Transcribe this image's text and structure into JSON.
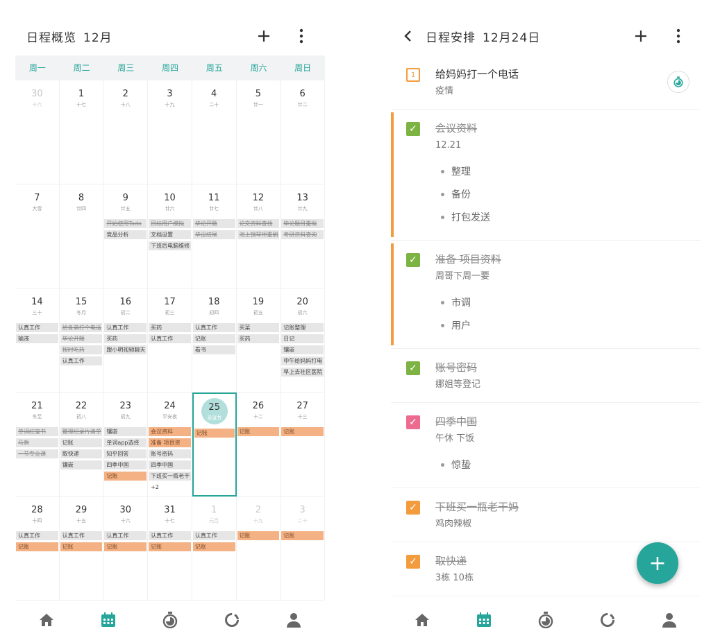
{
  "left": {
    "title": "日程概览",
    "month": "12月",
    "weekdays": [
      "周一",
      "周二",
      "周三",
      "周四",
      "周五",
      "周六",
      "周日"
    ],
    "weeks": [
      [
        {
          "d": "30",
          "l": "十六",
          "dim": true,
          "ev": []
        },
        {
          "d": "1",
          "l": "十七",
          "ev": []
        },
        {
          "d": "2",
          "l": "十八",
          "ev": []
        },
        {
          "d": "3",
          "l": "十九",
          "ev": []
        },
        {
          "d": "4",
          "l": "二十",
          "ev": []
        },
        {
          "d": "5",
          "l": "廿一",
          "ev": []
        },
        {
          "d": "6",
          "l": "廿二",
          "ev": []
        }
      ],
      [
        {
          "d": "7",
          "l": "大雪",
          "ev": []
        },
        {
          "d": "8",
          "l": "廿四",
          "ev": []
        },
        {
          "d": "9",
          "l": "廿五",
          "ev": [
            {
              "t": "开始使用Todo",
              "s": "done"
            },
            {
              "t": "竞品分析",
              "s": ""
            }
          ]
        },
        {
          "d": "10",
          "l": "廿六",
          "ev": [
            {
              "t": "目标用户模拟",
              "s": "done"
            },
            {
              "t": "文档设置",
              "s": ""
            },
            {
              "t": "下班后电脑维修",
              "s": ""
            }
          ]
        },
        {
          "d": "11",
          "l": "廿七",
          "ev": [
            {
              "t": "毕论开题",
              "s": "done"
            },
            {
              "t": "毕设结尾",
              "s": "done"
            }
          ]
        },
        {
          "d": "12",
          "l": "廿八",
          "ev": [
            {
              "t": "论文资料查找",
              "s": "done"
            },
            {
              "t": "海上钢琴师重刷",
              "s": "done"
            }
          ]
        },
        {
          "d": "13",
          "l": "廿九",
          "ev": [
            {
              "t": "毕论题目重拟",
              "s": "done"
            },
            {
              "t": "考研资料查询",
              "s": "done"
            }
          ]
        }
      ],
      [
        {
          "d": "14",
          "l": "三十",
          "ev": [
            {
              "t": "认真工作",
              "s": ""
            },
            {
              "t": "输液",
              "s": ""
            }
          ]
        },
        {
          "d": "15",
          "l": "冬月",
          "ev": [
            {
              "t": "给各弟打个电话",
              "s": "done"
            },
            {
              "t": "毕论开题",
              "s": "done"
            },
            {
              "t": "按时吃药",
              "s": "done"
            },
            {
              "t": "认真工作",
              "s": ""
            }
          ]
        },
        {
          "d": "16",
          "l": "初二",
          "ev": [
            {
              "t": "认真工作",
              "s": ""
            },
            {
              "t": "买药",
              "s": ""
            },
            {
              "t": "跟小明视频聊天",
              "s": ""
            }
          ]
        },
        {
          "d": "17",
          "l": "初三",
          "ev": [
            {
              "t": "买药",
              "s": ""
            },
            {
              "t": "认真工作",
              "s": ""
            }
          ]
        },
        {
          "d": "18",
          "l": "初四",
          "ev": [
            {
              "t": "认真工作",
              "s": ""
            },
            {
              "t": "记账",
              "s": ""
            },
            {
              "t": "看书",
              "s": ""
            }
          ]
        },
        {
          "d": "19",
          "l": "初五",
          "ev": [
            {
              "t": "买菜",
              "s": ""
            },
            {
              "t": "买药",
              "s": ""
            }
          ]
        },
        {
          "d": "20",
          "l": "初六",
          "ev": [
            {
              "t": "记账整理",
              "s": ""
            },
            {
              "t": "日记",
              "s": ""
            },
            {
              "t": "镶嵌",
              "s": ""
            },
            {
              "t": "中午给妈妈打电",
              "s": ""
            },
            {
              "t": "早上去社区医院",
              "s": ""
            }
          ]
        }
      ],
      [
        {
          "d": "21",
          "l": "冬至",
          "ev": [
            {
              "t": "单词红宝书",
              "s": "done"
            },
            {
              "t": "马哲",
              "s": "done"
            },
            {
              "t": "一节专业课",
              "s": "done"
            }
          ]
        },
        {
          "d": "22",
          "l": "初八",
          "ev": [
            {
              "t": "整理纪录片清单",
              "s": "done"
            },
            {
              "t": "记账",
              "s": ""
            },
            {
              "t": "取快递",
              "s": ""
            },
            {
              "t": "镶嵌",
              "s": ""
            }
          ]
        },
        {
          "d": "23",
          "l": "初九",
          "ev": [
            {
              "t": "镶嵌",
              "s": ""
            },
            {
              "t": "单词app选择",
              "s": ""
            },
            {
              "t": "知乎回答",
              "s": ""
            },
            {
              "t": "四季中国",
              "s": ""
            },
            {
              "t": "记账",
              "s": "or"
            }
          ]
        },
        {
          "d": "24",
          "l": "平安夜",
          "ev": [
            {
              "t": "会议资料",
              "s": "or"
            },
            {
              "t": "准备  项目资",
              "s": "or"
            },
            {
              "t": "账号密码",
              "s": ""
            },
            {
              "t": "四季中国",
              "s": ""
            },
            {
              "t": "下班买一瓶老干",
              "s": ""
            },
            {
              "t": "+2",
              "s": "more"
            }
          ]
        },
        {
          "d": "25",
          "l": "圣诞节",
          "today": true,
          "ev": [
            {
              "t": "记账",
              "s": "or"
            }
          ]
        },
        {
          "d": "26",
          "l": "十二",
          "ev": [
            {
              "t": "记账",
              "s": "or"
            }
          ]
        },
        {
          "d": "27",
          "l": "十三",
          "ev": [
            {
              "t": "记账",
              "s": "or"
            }
          ]
        }
      ],
      [
        {
          "d": "28",
          "l": "十四",
          "ev": [
            {
              "t": "认真工作",
              "s": ""
            },
            {
              "t": "记账",
              "s": "or"
            }
          ]
        },
        {
          "d": "29",
          "l": "十五",
          "ev": [
            {
              "t": "认真工作",
              "s": ""
            },
            {
              "t": "记账",
              "s": "or"
            }
          ]
        },
        {
          "d": "30",
          "l": "十六",
          "ev": [
            {
              "t": "认真工作",
              "s": ""
            },
            {
              "t": "记账",
              "s": "or"
            }
          ]
        },
        {
          "d": "31",
          "l": "十七",
          "ev": [
            {
              "t": "认真工作",
              "s": ""
            },
            {
              "t": "记账",
              "s": "or"
            }
          ]
        },
        {
          "d": "1",
          "l": "元旦",
          "dim": true,
          "ev": [
            {
              "t": "认真工作",
              "s": ""
            },
            {
              "t": "记账",
              "s": "or"
            }
          ]
        },
        {
          "d": "2",
          "l": "十九",
          "dim": true,
          "ev": [
            {
              "t": "记账",
              "s": "or"
            }
          ]
        },
        {
          "d": "3",
          "l": "二十",
          "dim": true,
          "ev": [
            {
              "t": "记账",
              "s": "or"
            }
          ]
        }
      ]
    ]
  },
  "right": {
    "title": "日程安排",
    "date": "12月24日",
    "tasks": [
      {
        "title": "给妈妈打一个电话",
        "sub": "疫情",
        "state": "box",
        "boxnum": "1",
        "timer": true,
        "bar": false,
        "items": []
      },
      {
        "title": "会议资料",
        "sub": "12.21",
        "state": "green",
        "bar": true,
        "items": [
          "整理",
          "备份",
          "打包发送"
        ]
      },
      {
        "title": "准备  项目资料",
        "sub": "周哥下周一要",
        "state": "green",
        "bar": true,
        "items": [
          "市调",
          "用户"
        ]
      },
      {
        "title": "账号密码",
        "sub": "娜姐等登记",
        "state": "green",
        "bar": false,
        "items": []
      },
      {
        "title": "四季中国",
        "sub": "午休 下饭",
        "state": "pink",
        "bar": false,
        "items": [
          "惊蛰"
        ]
      },
      {
        "title": "下班买一瓶老干妈",
        "sub": "鸡肉辣椒",
        "state": "orange",
        "bar": false,
        "items": []
      },
      {
        "title": "取快递",
        "sub": "3栋 10栋",
        "state": "orange",
        "bar": false,
        "items": []
      }
    ]
  },
  "colors": {
    "teal": "#26a69a",
    "orange": "#f39c3d",
    "green": "#7cb342",
    "pink": "#ec6b8e",
    "eventOrange": "#f4b183"
  },
  "nav": [
    "home-icon",
    "calendar-icon",
    "timer-icon",
    "stats-icon",
    "profile-icon"
  ],
  "active_nav": "calendar-icon"
}
